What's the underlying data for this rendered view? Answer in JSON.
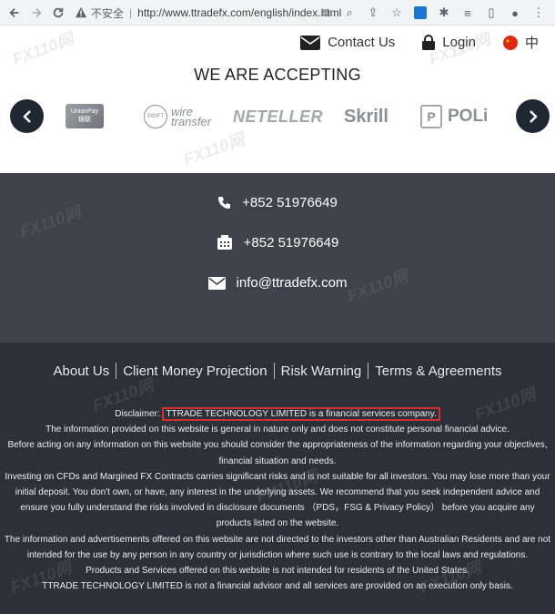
{
  "browser": {
    "security_label": "不安全",
    "url": "http://www.ttradefx.com/english/index.html"
  },
  "topnav": {
    "contact": "Contact Us",
    "login": "Login",
    "lang": "中"
  },
  "accepting": {
    "title": "WE ARE ACCEPTING",
    "logos": {
      "unionpay_line1": "UnionPay",
      "unionpay_line2": "银联",
      "swift": "SWIFT",
      "wire_line1": "wire",
      "wire_line2": "transfer",
      "neteller": "NETELLER",
      "skrill": "Skrill",
      "poli_box": "P",
      "poli": "POLi"
    }
  },
  "contact": {
    "phone": "+852 51976649",
    "fax": "+852 51976649",
    "email": "info@ttradefx.com"
  },
  "footer": {
    "links": [
      "About Us",
      "Client Money Projection",
      "Risk Warning",
      "Terms & Agreements"
    ],
    "disclaimer_label": "Disclaimer:",
    "disclaimer_highlight": "TTRADE TECHNOLOGY LIMITED is a financial services company.",
    "p1": "The information provided on this website is general in nature only and does not constitute personal financial advice.",
    "p2": "Before acting on any information on this website you should consider the appropriateness of the information regarding your objectives, financial situation and needs.",
    "p3": "Investing on CFDs and Margined FX Contracts carries significant risks and is not suitable for all investors. You may lose more than your initial deposit. You don't own, or have, any interest in the underlying assets. We recommend that you seek independent advice and ensure you fully understand the risks involved in disclosure documents （PDS，FSG & Privacy Policy） before you acquire any products listed on the website.",
    "p4": "The information and advertisements offered on this website are not directed to the investors other than Australian Residents and are not intended for the use by any person in any country or jurisdiction where such use is contrary to the local laws and regulations.",
    "p5": "Products and Services offered on this website is not intended for residents of the United States.",
    "p6": "TTRADE TECHNOLOGY LIMITED is not a financial advisor and all services are provided on an execution only basis."
  },
  "watermark": "FX110网",
  "colors": {
    "dark_contact": "#3e424b",
    "dark_footer": "#2c3039",
    "highlight_border": "#d32f2f"
  }
}
